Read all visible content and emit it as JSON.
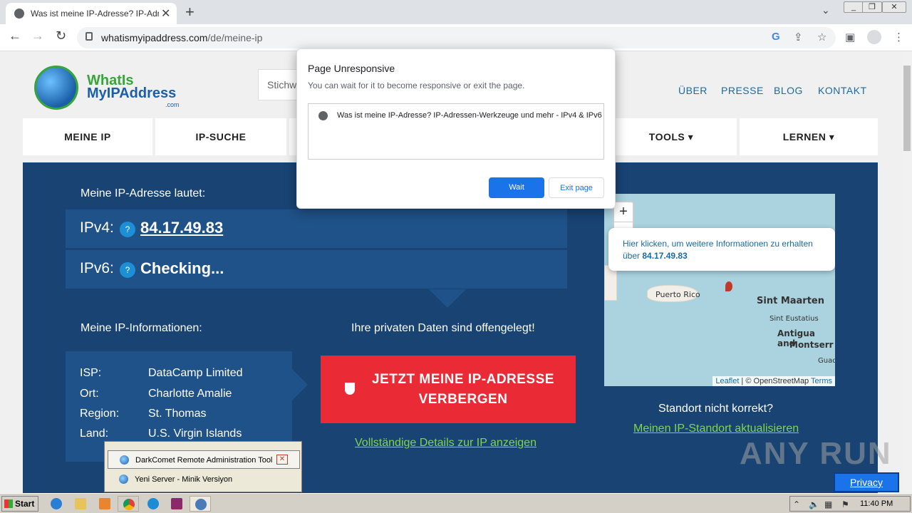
{
  "browser": {
    "tab_title": "Was ist meine IP-Adresse? IP-Adres",
    "url_host": "whatismyipaddress.com",
    "url_path": "/de/meine-ip"
  },
  "site": {
    "logo_line1": "WhatIs",
    "logo_line2": "MyIPAddress",
    "logo_line3": ".com",
    "search_placeholder": "Stichw",
    "top_links": [
      "ÜBER",
      "PRESSE",
      "BLOG",
      "KONTAKT"
    ],
    "nav": [
      "MEINE IP",
      "IP-SUCHE",
      "TOOLS ▾",
      "LERNEN ▾"
    ]
  },
  "hero": {
    "my_ip_label": "Meine IP-Adresse lautet:",
    "ipv4_key": "IPv4:",
    "ipv4_value": "84.17.49.83",
    "ipv6_key": "IPv6:",
    "ipv6_value": "Checking...",
    "info_label": "Meine IP-Informationen:",
    "exposed_label": "Ihre privaten Daten sind offengelegt!",
    "info_rows": [
      {
        "key": "ISP:",
        "value": "DataCamp Limited"
      },
      {
        "key": "Ort:",
        "value": "Charlotte Amalie"
      },
      {
        "key": "Region:",
        "value": "St. Thomas"
      },
      {
        "key": "Land:",
        "value": "U.S. Virgin Islands"
      }
    ],
    "hide_button": "JETZT MEINE IP-ADRESSE VERBERGEN",
    "details_link": "Vollständige Details zur IP anzeigen",
    "location_wrong": "Standort nicht korrekt?",
    "update_location_link": "Meinen IP-Standort aktualisieren"
  },
  "map": {
    "zoom_in": "+",
    "zoom_out": "−",
    "popup_line1": "Hier klicken, um weitere Informationen zu erhalten",
    "popup_line2_prefix": "über",
    "popup_ip": "84.17.49.83",
    "labels": [
      "Puerto Rico",
      "Sint Maarten",
      "Sint Eustatius",
      "Antigua and",
      "Montserr",
      "Guad"
    ],
    "attr_leaflet": "Leaflet",
    "attr_osm": "© OpenStreetMap",
    "attr_terms": "Terms"
  },
  "dialog": {
    "title": "Page Unresponsive",
    "message": "You can wait for it to become responsive or exit the page.",
    "page_item": "Was ist meine IP-Adresse? IP-Adressen-Werkzeuge und mehr - IPv4 & IPv6",
    "wait_label": "Wait",
    "exit_label": "Exit page"
  },
  "popup_menu": {
    "items": [
      "DarkComet Remote Administration Tool",
      "Yeni Server - Minik Versiyon"
    ]
  },
  "watermark": "ANY RUN",
  "privacy_label": "Privacy",
  "taskbar": {
    "start_label": "Start",
    "clock": "11:40 PM"
  }
}
